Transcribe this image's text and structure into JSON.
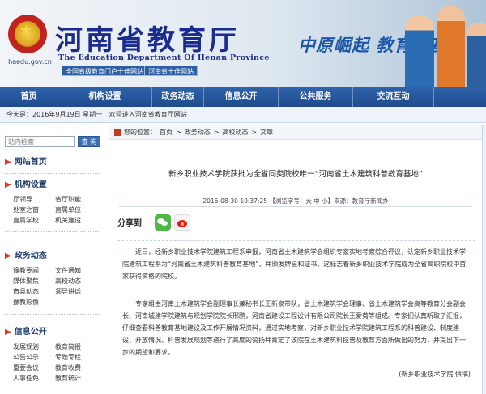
{
  "header": {
    "site_title": "河南省教育厅",
    "site_subtitle": "The Education Department Of Henan Province",
    "site_url": "haedu.gov.cn",
    "slogan": "中原崛起  教育为基",
    "portal_links": [
      "全国省级教育门户十佳网站",
      "河南省十佳网站"
    ]
  },
  "nav": {
    "items": [
      "首页",
      "机构设置",
      "政务动态",
      "信息公开",
      "公共服务",
      "交流互动"
    ]
  },
  "statusbar": {
    "date": "今天是：2016年9月19日 星期一",
    "welcome": "欢迎进入河南省教育厅网站"
  },
  "sidebar": {
    "search": {
      "placeholder": "站内检索",
      "button": "查 询"
    },
    "sections": [
      {
        "title": "网站首页",
        "items": []
      },
      {
        "title": "机构设置",
        "items": [
          "厅领导",
          "省厅职能",
          "处室之窗",
          "直属单位",
          "直属学校",
          "机关建设"
        ]
      },
      {
        "title": "政务动态",
        "items": [
          "豫教要闻",
          "文件通知",
          "媒体聚焦",
          "高校动态",
          "市县动态",
          "领导讲话",
          "豫教影像"
        ]
      },
      {
        "title": "信息公开",
        "items": [
          "发展规划",
          "教育简报",
          "公告公示",
          "专题专栏",
          "重要会议",
          "教育收费",
          "人事任免",
          "教育统计"
        ]
      }
    ]
  },
  "content": {
    "breadcrumb": {
      "label": "您的位置：",
      "items": [
        "首页",
        "政务动态",
        "高校动态",
        "文章"
      ],
      "sep": ">"
    },
    "title": "新乡职业技术学院获批为全省同类院校唯一“河南省土木建筑科普教育基地”",
    "meta": "2016-08-30 10:37:25 【浏览字号：大 中 小】来源：教育厅新闻办",
    "share_label": "分享到",
    "paragraphs": [
      "近日，经新乡职业技术学院建筑工程系申报，河南省土木建筑学会组织专家实地考察综合评议，认定新乡职业技术学院建筑工程系为“河南省土木建筑科普教育基地”，并颁发牌匾和证书，这标志着新乡职业技术学院成为全省高职院校中首家获得资格的院校。",
      "专家组由河南土木建筑学会副理事长兼秘书长王新泉带队，省土木建筑学会理事、省土木建筑学会高等教育分会副会长、河南城建学院建筑与规划学院院长邢鹏，河南省建设工程设计有限公司院长王爱菊等组成。专家们认真听取了汇报，仔细查看科普教育基地建设及工作开展情况资料，通过实地考察，对新乡职业技术学院建筑工程系的科普建设、制度建设、开放情况、科普发展规划等进行了高度的赞扬并肯定了该院在土木建筑科技普及教育方面所做出的努力，并提出下一步的期望和要求。"
    ],
    "signature": "(新乡职业技术学院 供稿)"
  },
  "colors": {
    "nav_bg": "#2a5a9f",
    "title_blue": "#1b2c8f",
    "accent_red": "#c43b23"
  }
}
